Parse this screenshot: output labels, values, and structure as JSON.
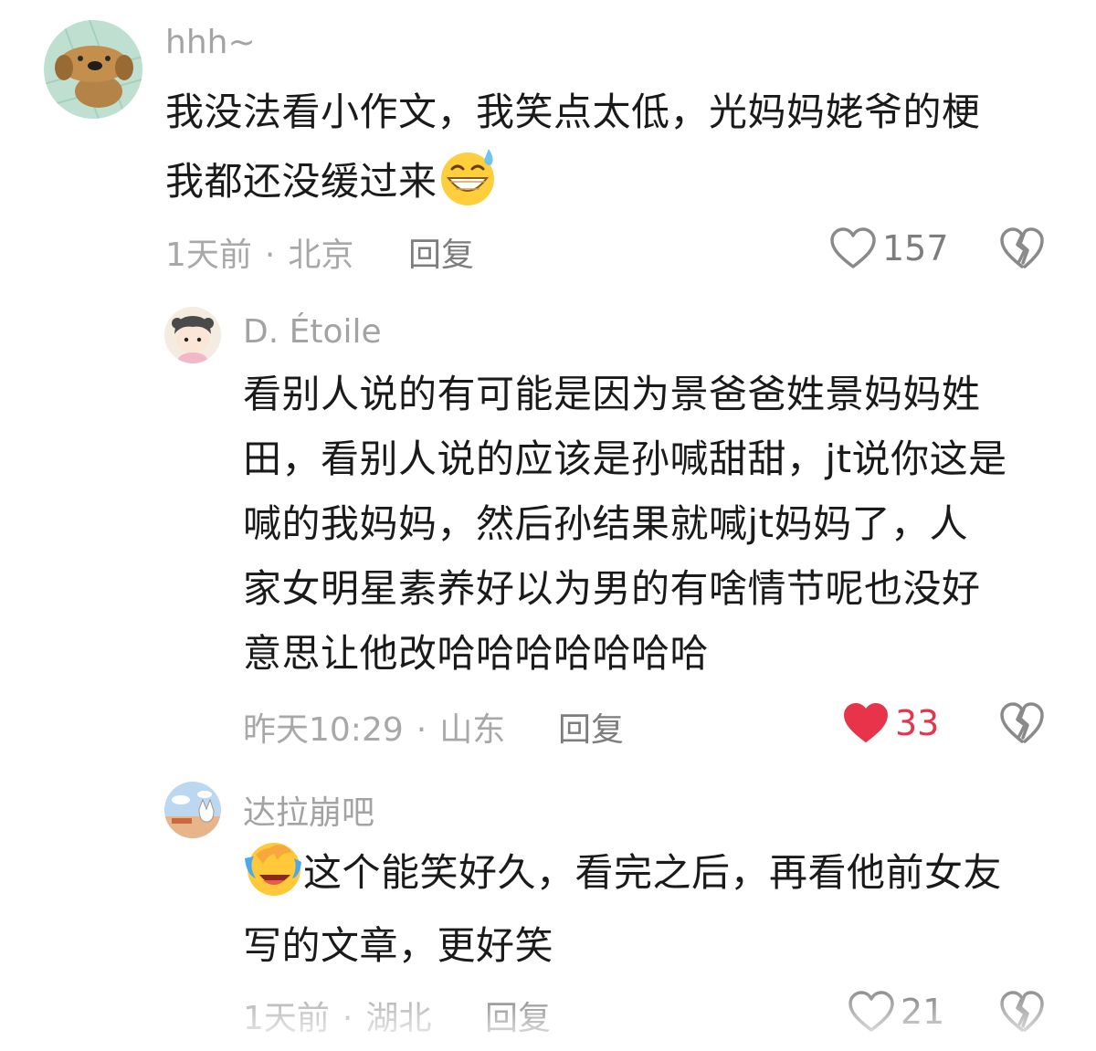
{
  "comments": [
    {
      "username": "hhh~",
      "text_1": "我没法看小作文，我笑点太低，光妈妈姥爷的梗",
      "text_2": "我都还没缓过来",
      "time": "1天前",
      "location": "北京",
      "reply_label": "回复",
      "likes": "157",
      "liked": false,
      "avatar_icon": "dog-avatar",
      "emoji_icon": "grinning-sweat-emoji"
    },
    {
      "username": "D. Étoile",
      "lines": [
        "看别人说的有可能是因为景爸爸姓景妈妈姓",
        "田，看别人说的应该是孙喊甜甜，jt说你这是",
        "喊的我妈妈，然后孙结果就喊jt妈妈了，人",
        "家女明星素养好以为男的有啥情节呢也没好",
        "意思让他改哈哈哈哈哈哈哈"
      ],
      "time": "昨天10:29",
      "location": "山东",
      "reply_label": "回复",
      "likes": "33",
      "liked": true,
      "avatar_icon": "girl-avatar"
    },
    {
      "username": "达拉崩吧",
      "text_1": "这个能笑好久，看完之后，再看他前女友",
      "text_2": "写的文章，更好笑",
      "time": "1天前",
      "location": "湖北",
      "reply_label": "回复",
      "likes": "21",
      "liked": false,
      "avatar_icon": "cat-sky-avatar",
      "emoji_icon": "laughing-crying-emoji"
    }
  ],
  "colors": {
    "liked": "#e8344a",
    "meta": "#a8a8a8",
    "text": "#1a1a1a"
  }
}
